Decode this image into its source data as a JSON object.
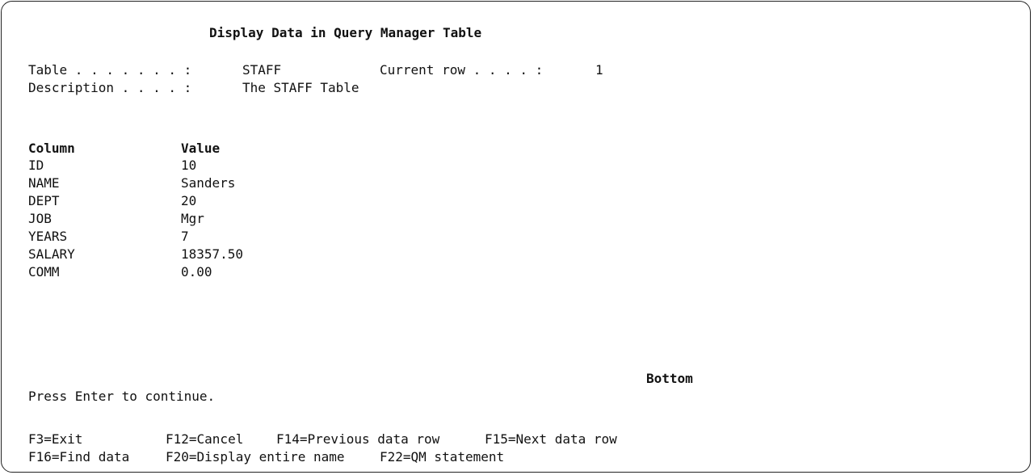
{
  "title": "Display Data in Query Manager Table",
  "header": {
    "table_label": "Table . . . . . . . :",
    "table_value": "STAFF",
    "current_row_label": "Current row . . . . :",
    "current_row_value": "1",
    "description_label": "Description . . . . :",
    "description_value": "The STAFF Table"
  },
  "columns": {
    "column_header": "Column",
    "value_header": "Value",
    "rows": [
      {
        "name": "ID",
        "value": "10"
      },
      {
        "name": "NAME",
        "value": "Sanders"
      },
      {
        "name": "DEPT",
        "value": "20"
      },
      {
        "name": "JOB",
        "value": "Mgr"
      },
      {
        "name": "YEARS",
        "value": "7"
      },
      {
        "name": "SALARY",
        "value": "18357.50"
      },
      {
        "name": "COMM",
        "value": "0.00"
      }
    ]
  },
  "bottom_indicator": "Bottom",
  "message": "Press Enter to continue.",
  "function_keys": {
    "f3": "F3=Exit",
    "f12": "F12=Cancel",
    "f14": "F14=Previous data row",
    "f15": "F15=Next data row",
    "f16": "F16=Find data",
    "f20": "F20=Display entire name",
    "f22": "F22=QM statement"
  }
}
